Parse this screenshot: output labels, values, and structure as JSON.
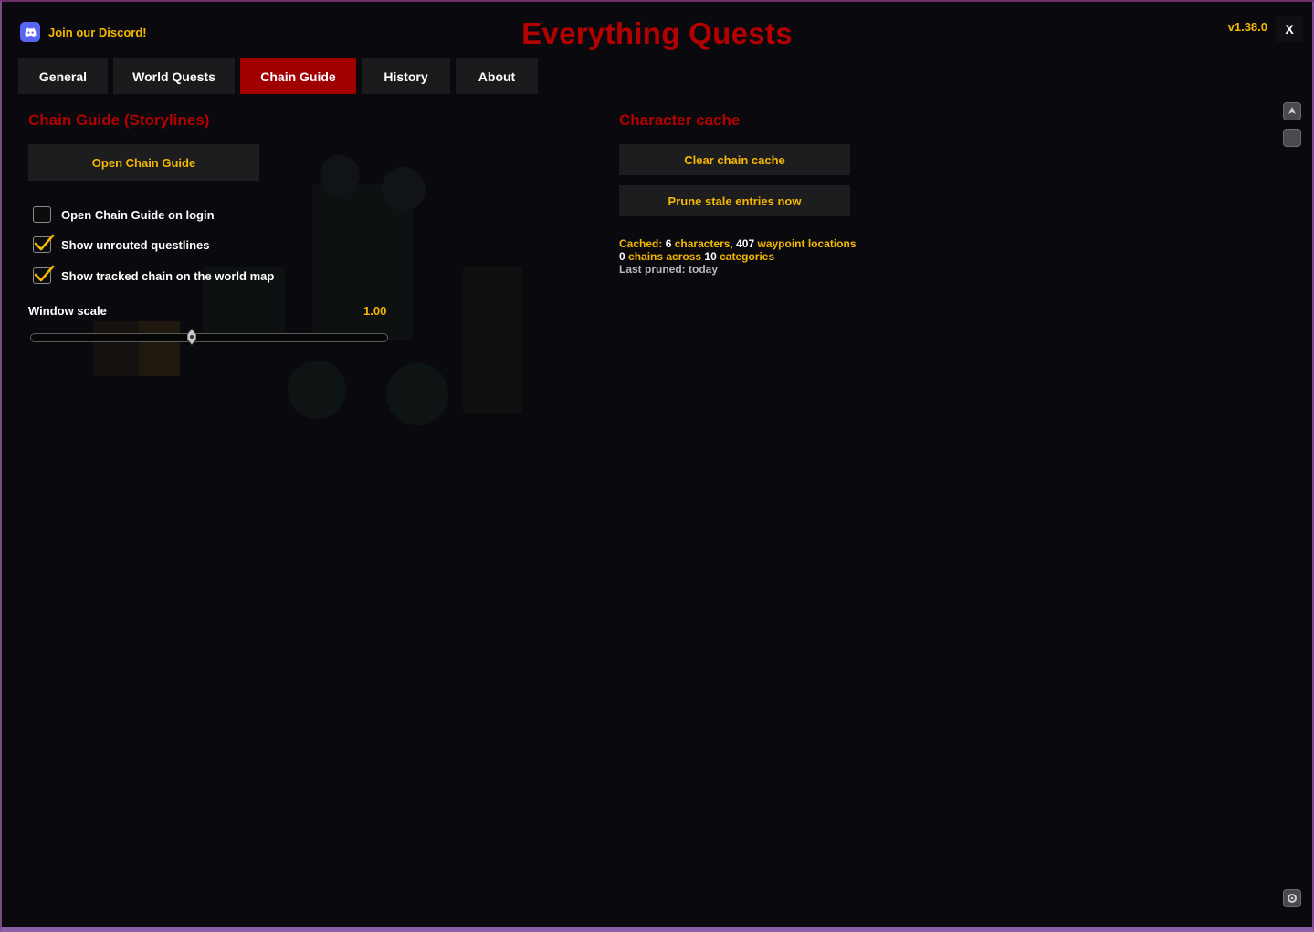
{
  "header": {
    "discord_label": "Join our Discord!",
    "app_title": "Everything Quests",
    "version": "v1.38.0",
    "close_label": "X"
  },
  "tabs": [
    {
      "label": "General",
      "active": false
    },
    {
      "label": "World Quests",
      "active": false
    },
    {
      "label": "Chain Guide",
      "active": true
    },
    {
      "label": "History",
      "active": false
    },
    {
      "label": "About",
      "active": false
    }
  ],
  "chain_guide": {
    "title": "Chain Guide (Storylines)",
    "open_button": "Open Chain Guide",
    "options": [
      {
        "label": "Open Chain Guide on login",
        "checked": false
      },
      {
        "label": "Show unrouted questlines",
        "checked": true
      },
      {
        "label": "Show tracked chain on the world map",
        "checked": true
      }
    ],
    "window_scale_label": "Window scale",
    "window_scale_value": "1.00",
    "window_scale_fraction": 0.45
  },
  "character_cache": {
    "title": "Character cache",
    "clear_button": "Clear chain cache",
    "prune_button": "Prune stale entries now",
    "cached_prefix": "Cached:",
    "characters_count": "6",
    "characters_word": "characters,",
    "waypoints_count": "407",
    "waypoints_word": "waypoint locations",
    "chains_count": "0",
    "chains_word": "chains across",
    "categories_count": "10",
    "categories_word": "categories",
    "last_pruned": "Last pruned: today"
  },
  "icons": {
    "discord": "discord-icon",
    "side_top": "map-pin-icon",
    "side_second": "square-icon",
    "side_bottom": "gear-icon"
  },
  "colors": {
    "accent_red": "#b30000",
    "active_tab": "#a10000",
    "gold": "#f5b800",
    "discord": "#5865f2"
  }
}
